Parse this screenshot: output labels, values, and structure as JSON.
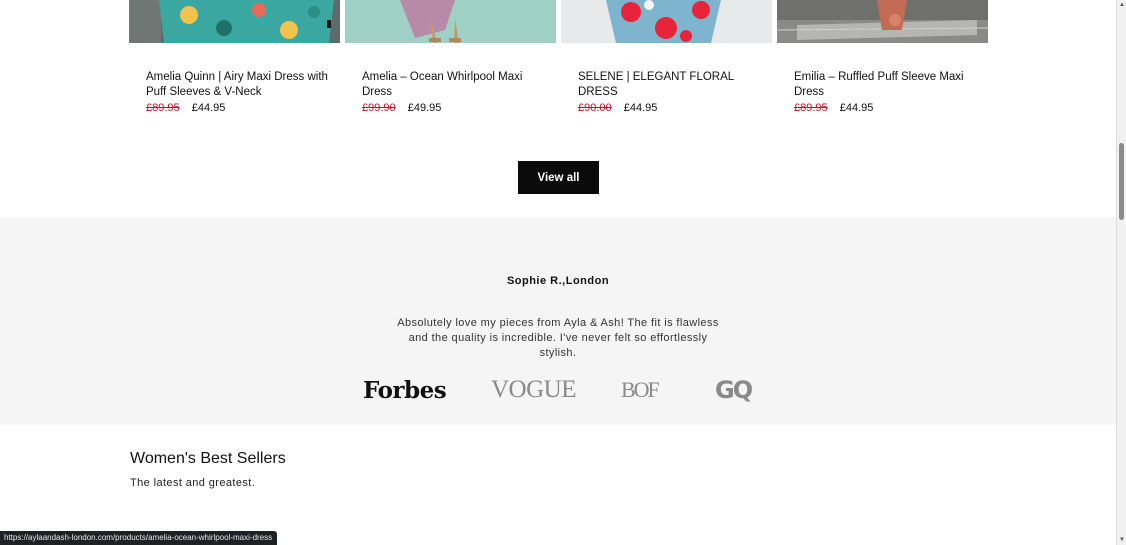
{
  "colors": {
    "sale_price": "#c8102e",
    "button_bg": "#0b0b0b",
    "band_bg": "#f5f5f5"
  },
  "products": [
    {
      "name": "Amelia Quinn | Airy Maxi Dress with Puff Sleeves & V-Neck",
      "old_price": "£89.95",
      "price": "£44.95"
    },
    {
      "name": "Amelia – Ocean Whirlpool Maxi Dress",
      "old_price": "£99.90",
      "price": "£49.95"
    },
    {
      "name": "SELENE | ELEGANT FLORAL DRESS",
      "old_price": "£90.00",
      "price": "£44.95"
    },
    {
      "name": "Emilia – Ruffled Puff Sleeve Maxi Dress",
      "old_price": "£89.95",
      "price": "£44.95"
    }
  ],
  "view_all_label": "View all",
  "testimonial": {
    "author": "Sophie R.,London",
    "quote": "Absolutely love my pieces from Ayla & Ash! The fit is flawless and the quality is incredible. I've never felt so effortlessly stylish.",
    "press_logos": [
      "Forbes",
      "VOGUE",
      "BOF",
      "GQ"
    ]
  },
  "best_sellers": {
    "title": "Women's Best Sellers",
    "subtitle": "The latest and greatest."
  },
  "status_url": "https://aylaandash-london.com/products/amelia-ocean-whirlpool-maxi-dress"
}
